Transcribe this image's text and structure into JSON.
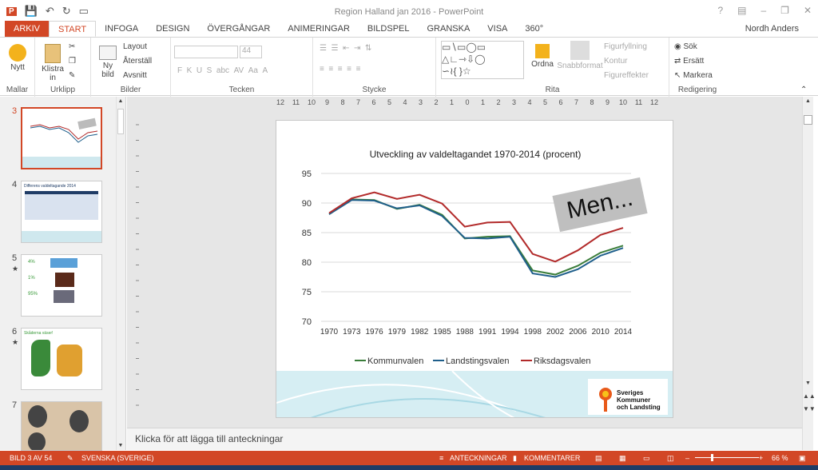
{
  "window": {
    "title": "Region Halland jan 2016 - PowerPoint",
    "user": "Nordh Anders"
  },
  "tabs": [
    "ARKIV",
    "START",
    "INFOGA",
    "DESIGN",
    "ÖVERGÅNGAR",
    "ANIMERINGAR",
    "BILDSPEL",
    "GRANSKA",
    "VISA",
    "360°"
  ],
  "ribbon": {
    "mallar": {
      "label": "Mallar",
      "nytt": "Nytt"
    },
    "urklipp": {
      "label": "Urklipp",
      "klistra": "Klistra",
      "in": "in"
    },
    "bilder": {
      "label": "Bilder",
      "ny": "Ny",
      "bild": "bild",
      "layout": "Layout",
      "aterstall": "Återställ",
      "avsnitt": "Avsnitt"
    },
    "tecken": {
      "label": "Tecken",
      "size": "44"
    },
    "stycke": {
      "label": "Stycke"
    },
    "rita": {
      "label": "Rita",
      "ordna": "Ordna",
      "snabbformat": "Snabbformat",
      "figurfyllning": "Figurfyllning",
      "kontur": "Kontur",
      "figureffekter": "Figureffekter"
    },
    "redigering": {
      "label": "Redigering",
      "sok": "Sök",
      "ersatt": "Ersätt",
      "markera": "Markera"
    }
  },
  "thumbnails": [
    {
      "num": "3",
      "star": ""
    },
    {
      "num": "4",
      "star": "",
      "title": "Differens valdeltagande 2014"
    },
    {
      "num": "5",
      "star": "★",
      "labels": [
        "4%",
        "1%",
        "95%"
      ]
    },
    {
      "num": "6",
      "star": "★",
      "title": "Skåderna väser!"
    },
    {
      "num": "7",
      "star": ""
    }
  ],
  "ruler": {
    "h": [
      "12",
      "11",
      "10",
      "9",
      "8",
      "7",
      "6",
      "5",
      "4",
      "3",
      "2",
      "1",
      "0",
      "1",
      "2",
      "3",
      "4",
      "5",
      "6",
      "7",
      "8",
      "9",
      "10",
      "11",
      "12"
    ]
  },
  "slide": {
    "men": "Men...",
    "logo": [
      "Sveriges",
      "Kommuner",
      "och Landsting"
    ]
  },
  "chart_data": {
    "type": "line",
    "title": "Utveckling av valdeltagandet 1970-2014 (procent)",
    "categories": [
      "1970",
      "1973",
      "1976",
      "1979",
      "1982",
      "1985",
      "1988",
      "1991",
      "1994",
      "1998",
      "2002",
      "2006",
      "2010",
      "2014"
    ],
    "ylim": [
      70,
      95
    ],
    "yticks": [
      "95",
      "90",
      "85",
      "80",
      "75",
      "70"
    ],
    "legend": "bottom",
    "grid": true,
    "series": [
      {
        "name": "Kommunvalen",
        "color": "#3a7d3a",
        "values": [
          88.1,
          90.6,
          90.5,
          89.0,
          89.7,
          88.0,
          84.0,
          84.3,
          84.4,
          78.6,
          77.9,
          79.4,
          81.6,
          82.8
        ]
      },
      {
        "name": "Landstingsvalen",
        "color": "#1f5f8b",
        "values": [
          88.1,
          90.5,
          90.4,
          89.1,
          89.6,
          87.8,
          84.1,
          84.0,
          84.3,
          78.1,
          77.5,
          78.8,
          81.1,
          82.4
        ]
      },
      {
        "name": "Riksdagsvalen",
        "color": "#b22a2a",
        "values": [
          88.3,
          90.8,
          91.8,
          90.7,
          91.4,
          89.9,
          86.0,
          86.7,
          86.8,
          81.4,
          80.1,
          82.0,
          84.6,
          85.8
        ]
      }
    ]
  },
  "notes": "Klicka för att lägga till anteckningar",
  "status": {
    "slide": "BILD 3 AV 54",
    "lang": "SVENSKA (SVERIGE)",
    "notes": "ANTECKNINGAR",
    "comments": "KOMMENTARER",
    "zoom": "66 %"
  }
}
